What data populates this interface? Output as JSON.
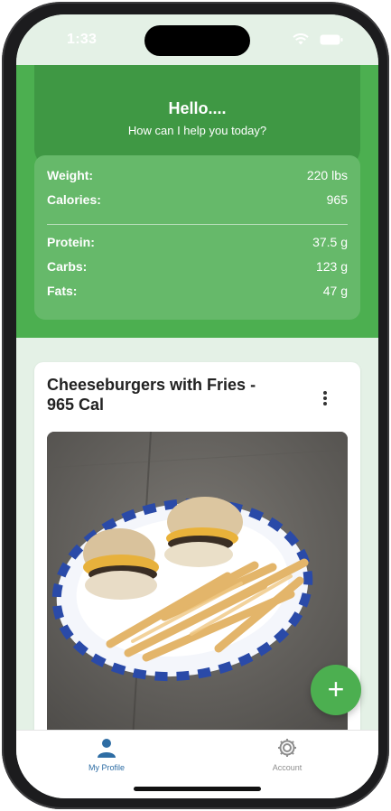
{
  "status_bar": {
    "time": "1:33",
    "icons": [
      "wifi-icon",
      "battery-icon"
    ]
  },
  "header": {
    "greeting": "Hello....",
    "subtitle": "How can I help you today?"
  },
  "stats": {
    "weight_label": "Weight:",
    "weight_value": "220 lbs",
    "calories_label": "Calories:",
    "calories_value": "965",
    "protein_label": "Protein:",
    "protein_value": "37.5 g",
    "carbs_label": "Carbs:",
    "carbs_value": "123 g",
    "fats_label": "Fats:",
    "fats_value": "47 g"
  },
  "post": {
    "title": "Cheeseburgers with Fries - 965 Cal",
    "menu_icon": "more-vertical-icon",
    "image": "photo of cheeseburgers with fries on a paper plate"
  },
  "fab": {
    "label": "+",
    "icon": "plus-icon"
  },
  "tabbar": {
    "items": [
      {
        "label": "My Profile",
        "icon": "person-icon",
        "active": true
      },
      {
        "label": "Account",
        "icon": "gear-icon",
        "active": false
      }
    ]
  },
  "colors": {
    "primary_green": "#4caf50",
    "header_dark_green": "#3f9844",
    "stats_green": "#66b96a",
    "background": "#e4f1e6",
    "active_tab": "#2e6da4",
    "inactive_tab": "#8e8e8e"
  }
}
